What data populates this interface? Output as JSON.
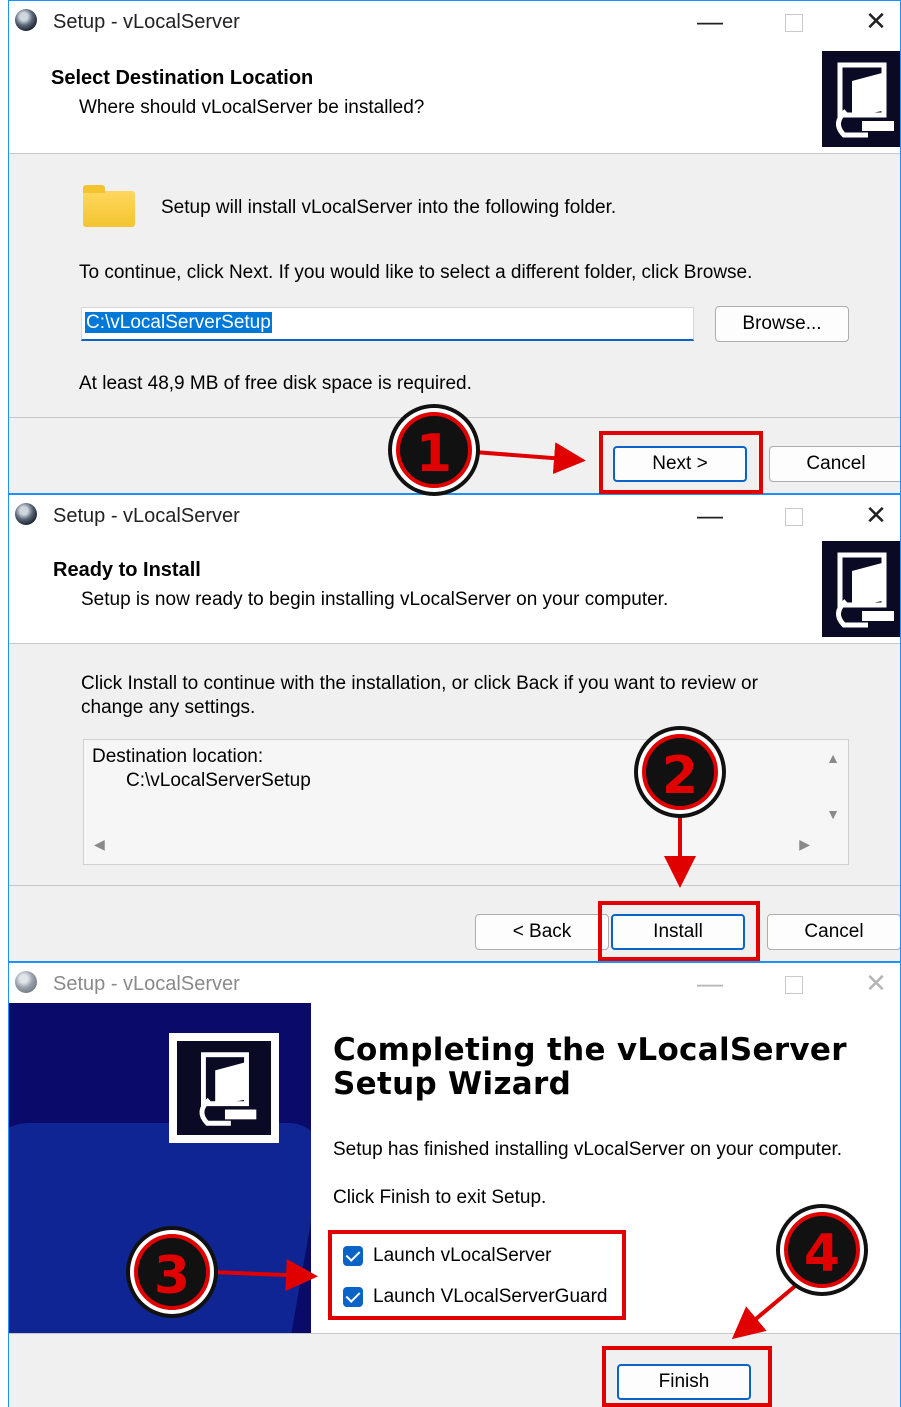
{
  "window_title": "Setup - vLocalServer",
  "titlebar": {
    "minimize": "—",
    "close": "✕"
  },
  "step1": {
    "heading": "Select Destination Location",
    "subheading": "Where should vLocalServer be installed?",
    "folder_text": "Setup will install vLocalServer into the following folder.",
    "instruction": "To continue, click Next. If you would like to select a different folder, click Browse.",
    "path_value": "C:\\vLocalServerSetup",
    "browse_label": "Browse...",
    "disk_space": "At least 48,9 MB of free disk space is required.",
    "next_label": "Next >",
    "cancel_label": "Cancel"
  },
  "step2": {
    "heading": "Ready to Install",
    "subheading": "Setup is now ready to begin installing vLocalServer on your computer.",
    "instruction_line1": "Click Install to continue with the installation, or click Back if you want to review or",
    "instruction_line2": "change any settings.",
    "memo_label": "Destination location:",
    "memo_value": "C:\\vLocalServerSetup",
    "back_label": "< Back",
    "install_label": "Install",
    "cancel_label": "Cancel"
  },
  "step3": {
    "title_line1": "Completing the vLocalServer",
    "title_line2": "Setup Wizard",
    "finished_text": "Setup has finished installing vLocalServer on your computer.",
    "exit_text": "Click Finish to exit Setup.",
    "checkboxes": [
      {
        "label": "Launch vLocalServer",
        "checked": true
      },
      {
        "label": "Launch VLocalServerGuard",
        "checked": true
      }
    ],
    "finish_label": "Finish"
  },
  "annotations": [
    "1",
    "2",
    "3",
    "4"
  ],
  "colors": {
    "highlight": "#e00000",
    "accent": "#0a64c8",
    "window_border": "#1e90ff",
    "wizard_bg": "#0a0a6a"
  }
}
